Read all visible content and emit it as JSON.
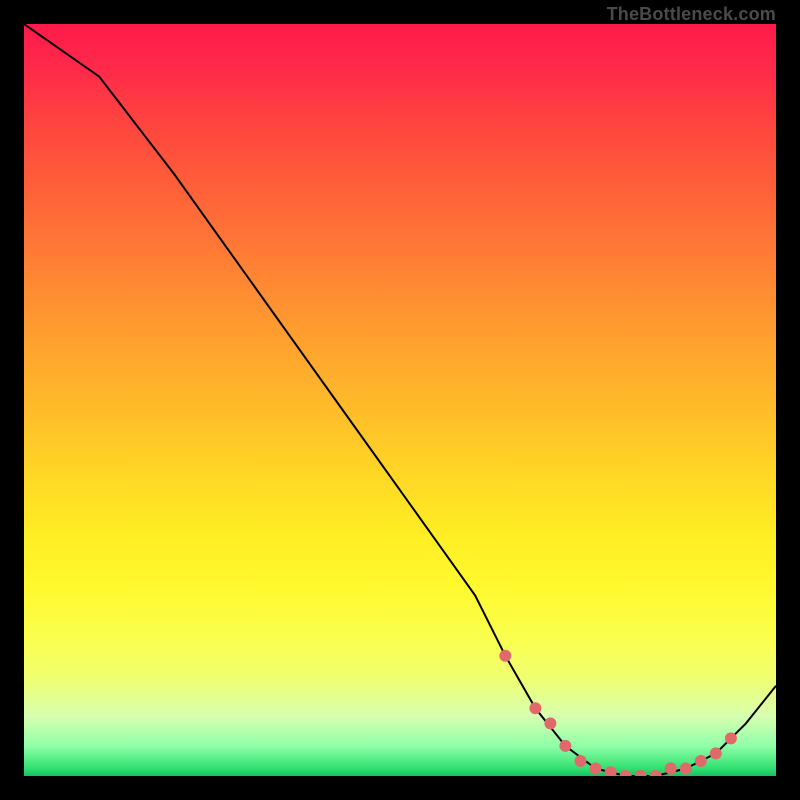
{
  "attribution": "TheBottleneck.com",
  "chart_data": {
    "type": "line",
    "title": "",
    "xlabel": "",
    "ylabel": "",
    "xlim": [
      0,
      100
    ],
    "ylim": [
      0,
      100
    ],
    "series": [
      {
        "name": "bottleneck-curve",
        "x": [
          0,
          10,
          20,
          30,
          40,
          50,
          60,
          64,
          68,
          72,
          76,
          80,
          84,
          88,
          92,
          96,
          100
        ],
        "y": [
          100,
          93,
          80,
          66,
          52,
          38,
          24,
          16,
          9,
          4,
          1,
          0,
          0,
          1,
          3,
          7,
          12
        ]
      }
    ],
    "markers": {
      "name": "highlight-points",
      "color": "#e06a6a",
      "x": [
        64,
        68,
        70,
        72,
        74,
        76,
        78,
        80,
        82,
        84,
        86,
        88,
        90,
        92,
        94
      ],
      "y": [
        16,
        9,
        7,
        4,
        2,
        1,
        0.5,
        0,
        0,
        0,
        1,
        1,
        2,
        3,
        5
      ]
    },
    "colors": {
      "curve": "#000000",
      "marker": "#e06a6a",
      "gradient_top": "#ff1a4a",
      "gradient_mid": "#ffee24",
      "gradient_bottom": "#18c060"
    }
  }
}
